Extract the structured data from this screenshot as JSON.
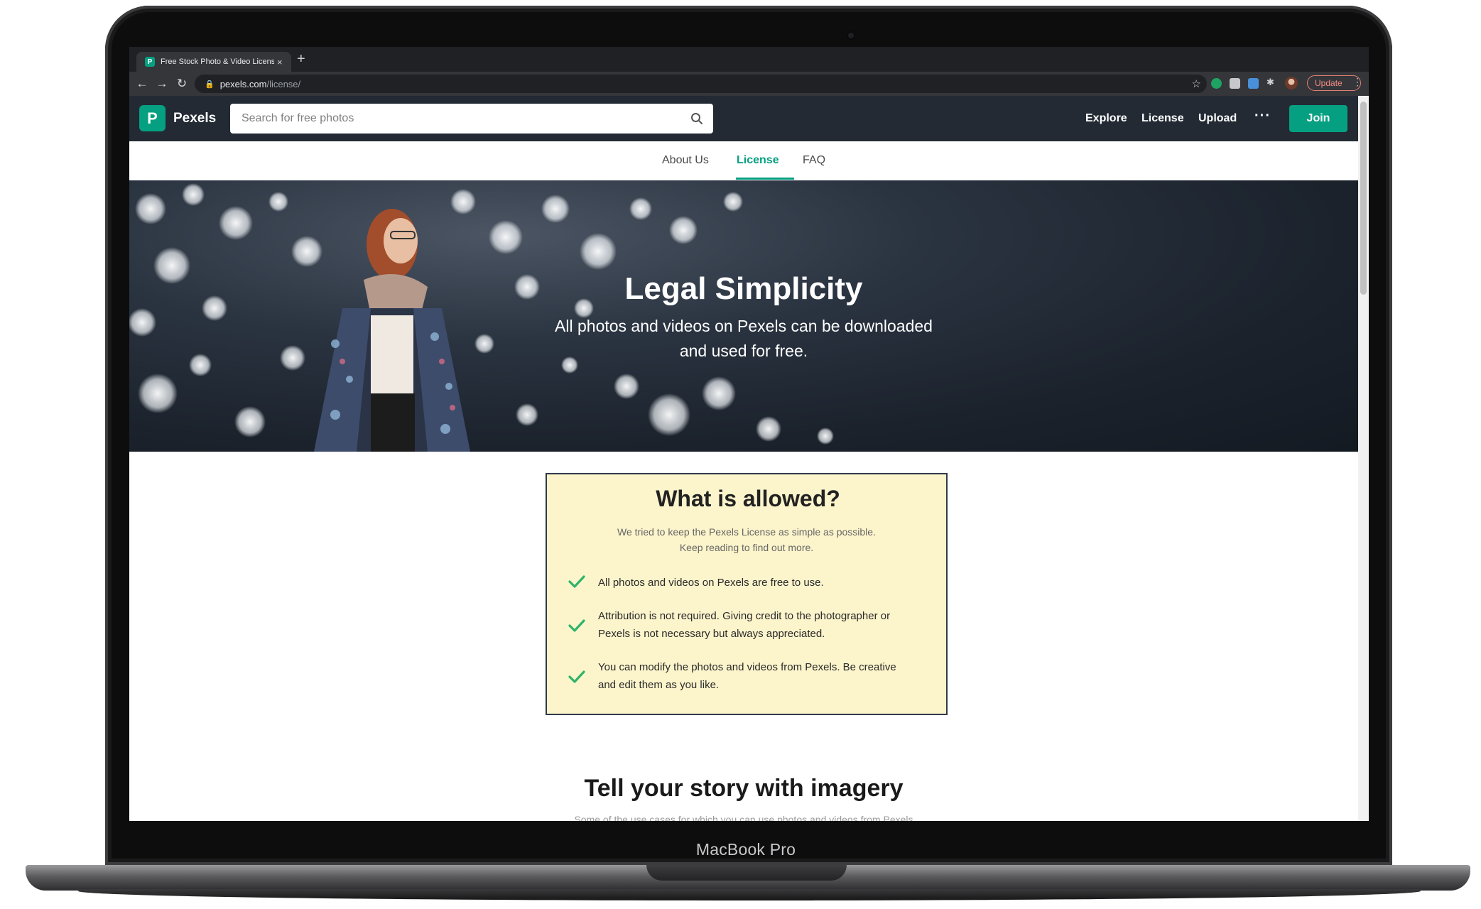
{
  "device": {
    "label": "MacBook Pro"
  },
  "browser": {
    "tab_title": "Free Stock Photo & Video License",
    "tab_close": "×",
    "new_tab": "+",
    "url_host": "pexels.com",
    "url_path": "/license/",
    "update_label": "Update",
    "icons": [
      "back-icon",
      "forward-icon",
      "reload-icon",
      "lock-icon",
      "star-icon",
      "extension-icons",
      "profile-avatar",
      "kebab-menu-icon"
    ]
  },
  "header": {
    "logo_letter": "P",
    "brand": "Pexels",
    "search_placeholder": "Search for free photos",
    "nav": {
      "explore": "Explore",
      "license": "License",
      "upload": "Upload"
    },
    "more": "···",
    "join": "Join",
    "brand_color": "#05a081",
    "background_color": "#232a34"
  },
  "subnav": {
    "about": "About Us",
    "license": "License",
    "faq": "FAQ",
    "active": "License"
  },
  "hero": {
    "title": "Legal Simplicity",
    "subtitle_line1": "All photos and videos on Pexels can be downloaded",
    "subtitle_line2": "and used for free."
  },
  "allowed": {
    "title": "What is allowed?",
    "intro_line1": "We tried to keep the Pexels License as simple as possible.",
    "intro_line2": "Keep reading to find out more.",
    "background_color": "#fcf4cb",
    "items": [
      {
        "line1": "All photos and videos on Pexels are free to use.",
        "line2": ""
      },
      {
        "line1": "Attribution is not required. Giving credit to the photographer or",
        "line2": "Pexels is not necessary but always appreciated."
      },
      {
        "line1": "You can modify the photos and videos from Pexels. Be creative",
        "line2": "and edit them as you like."
      }
    ]
  },
  "story": {
    "title": "Tell your story with imagery",
    "subtitle": "Some of the use cases for which you can use photos and videos from Pexels"
  }
}
